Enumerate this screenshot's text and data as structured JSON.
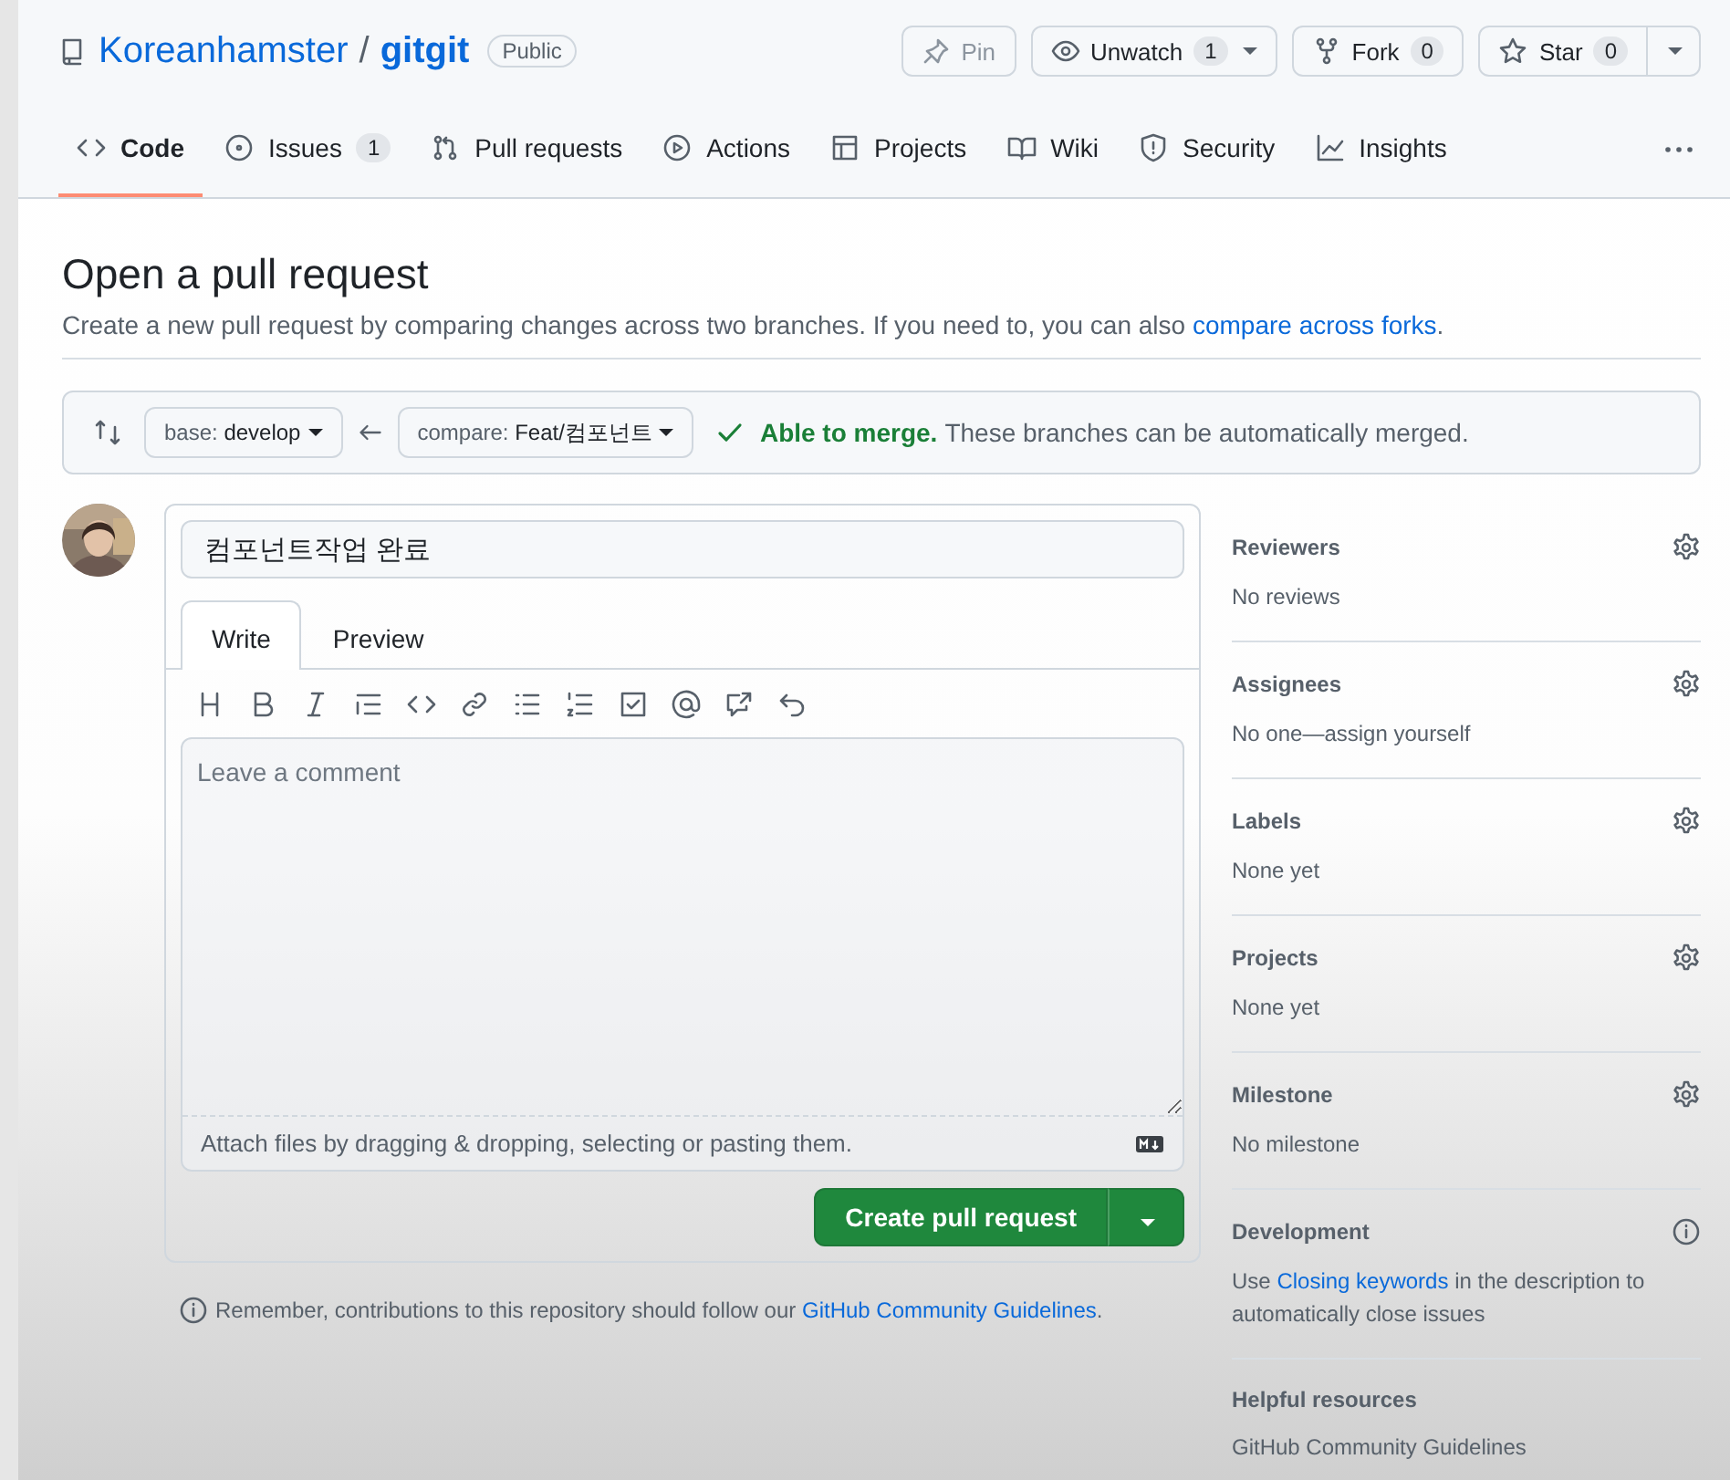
{
  "repo": {
    "owner": "Koreanhamster",
    "separator": "/",
    "name": "gitgit",
    "visibility": "Public"
  },
  "actions": [
    {
      "label": "Pin",
      "kind": "plain",
      "disabled": true
    },
    {
      "label": "Unwatch",
      "count": "1",
      "kind": "menu",
      "disabled": false
    },
    {
      "label": "Fork",
      "count": "0",
      "kind": "plain",
      "disabled": false
    },
    {
      "label": "Star",
      "count": "0",
      "kind": "split",
      "disabled": false
    }
  ],
  "nav": [
    {
      "label": "Code",
      "selected": true
    },
    {
      "label": "Issues",
      "count": "1",
      "selected": false
    },
    {
      "label": "Pull requests",
      "selected": false
    },
    {
      "label": "Actions",
      "selected": false
    },
    {
      "label": "Projects",
      "selected": false
    },
    {
      "label": "Wiki",
      "selected": false
    },
    {
      "label": "Security",
      "selected": false
    },
    {
      "label": "Insights",
      "selected": false
    }
  ],
  "heading": "Open a pull request",
  "subtitle": "Create a new pull request by comparing changes across two branches. If you need to, you can also",
  "subtitle_link": "compare across forks",
  "subtitle_end": ".",
  "compare_bar": {
    "base": {
      "prefix": "base:",
      "value": "develop"
    },
    "head": {
      "prefix": "compare:",
      "value": "Feat/컴포넌트"
    },
    "status": "Able to merge.",
    "status_text": "These branches can be automatically merged."
  },
  "form": {
    "title_value": "컴포넌트작업 완료",
    "tabs": [
      {
        "label": "Write",
        "selected": true
      },
      {
        "label": "Preview",
        "selected": false
      }
    ],
    "comment_placeholder": "Leave a comment",
    "attach_hint": "Attach files by dragging & dropping, selecting or pasting them.",
    "submit": "Create pull request"
  },
  "note": {
    "text": "Remember, contributions to this repository should follow our",
    "link": "GitHub Community Guidelines",
    "end": "."
  },
  "sidebar": [
    {
      "title": "Reviewers",
      "value": "No reviews",
      "kind": "gear"
    },
    {
      "title": "Assignees",
      "value": "No one—assign yourself",
      "kind": "gear"
    },
    {
      "title": "Labels",
      "value": "None yet",
      "kind": "gear"
    },
    {
      "title": "Projects",
      "value": "None yet",
      "kind": "gear"
    },
    {
      "title": "Milestone",
      "value": "No milestone",
      "kind": "gear"
    },
    {
      "title": "Development",
      "kind": "info",
      "prefix": "Use",
      "link": "Closing keywords",
      "suffix": "in the description to automatically close issues"
    },
    {
      "title": "Helpful resources",
      "kind": "links",
      "link": "GitHub Community Guidelines"
    }
  ]
}
